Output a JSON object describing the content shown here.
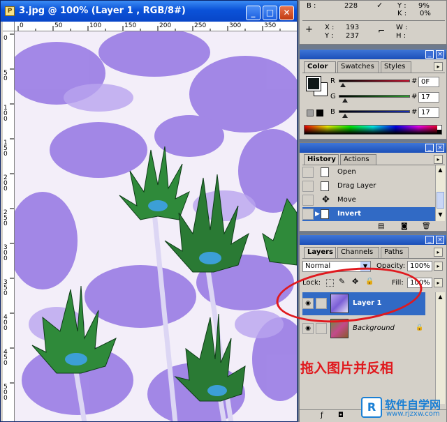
{
  "document": {
    "title": "3.jpg @ 100% (Layer 1 , RGB/8#)",
    "ruler_h_labels": [
      "0",
      "50",
      "100",
      "150",
      "200",
      "250",
      "300",
      "350"
    ],
    "ruler_v_labels": [
      "0",
      "5 0",
      "1 0 0",
      "1 5 0",
      "2 0 0",
      "2 5 0",
      "3 0 0",
      "3 5 0",
      "4 0 0",
      "4 5 0",
      "5 0 0"
    ],
    "controls": {
      "minimize": "_",
      "maximize": "□",
      "close": "✕"
    }
  },
  "info_panel": {
    "b_label": "B :",
    "b_value": "228",
    "y_label": "Y :",
    "y_value": "9%",
    "k_label": "K :",
    "k_value": "0%",
    "x_label": "X :",
    "x_value": "193",
    "ycoord_label": "Y :",
    "ycoord_value": "237",
    "w_label": "W :",
    "h_label": "H :"
  },
  "color_panel": {
    "tabs": [
      "Color",
      "Swatches",
      "Styles"
    ],
    "active_tab": "Color",
    "channels": [
      {
        "label": "R",
        "value": "0F",
        "color": "#c8102e",
        "level": 0.06
      },
      {
        "label": "G",
        "value": "17",
        "color": "#2e9e2e",
        "level": 0.09
      },
      {
        "label": "B",
        "value": "17",
        "color": "#1a2fb8",
        "level": 0.09
      }
    ],
    "hash": "#"
  },
  "history_panel": {
    "tabs": [
      "History",
      "Actions"
    ],
    "active_tab": "History",
    "items": [
      {
        "label": "Open",
        "selected": false
      },
      {
        "label": "Drag Layer",
        "selected": false
      },
      {
        "label": "Move",
        "selected": false
      },
      {
        "label": "Invert",
        "selected": true
      }
    ]
  },
  "layers_panel": {
    "tabs": [
      "Layers",
      "Channels",
      "Paths"
    ],
    "active_tab": "Layers",
    "blend_mode": "Normal",
    "opacity_label": "Opacity:",
    "opacity_value": "100%",
    "lock_label": "Lock:",
    "fill_label": "Fill:",
    "fill_value": "100%",
    "layers": [
      {
        "name": "Layer 1",
        "selected": true
      },
      {
        "name": "Background",
        "selected": false
      }
    ]
  },
  "annotation_text": "拖入图片并反相",
  "watermark": {
    "brand": "软件自学网",
    "url": "www.rjzxw.com"
  },
  "colors": {
    "accent": "#316ac5",
    "title_bar": "#0b52d8",
    "annotation": "#e0191e",
    "petal_purple": "#9b7ee6",
    "leaf_green": "#2f8a3a"
  }
}
